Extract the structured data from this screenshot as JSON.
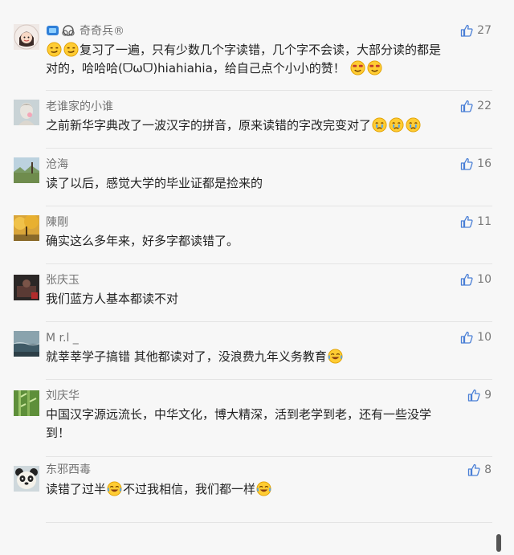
{
  "comments": [
    {
      "name": "奇奇兵®",
      "parts": [
        "",
        "复习了一遍，只有少数几个字读错，几个字不会读，大部分读的都是",
        "对的，哈哈哈(ᗜωᗜ)hiahiahia，给自己点个小小的赞！",
        ""
      ],
      "likes": "27",
      "avatar": "avatar-cartoon-girl",
      "emoji_icons": [
        "smirk-face-icon",
        "smirk-face-icon",
        "cool-face-icon",
        "cool-face-icon"
      ]
    },
    {
      "name": "老谁家的小谁",
      "parts": [
        "之前新华字典改了一波汉字的拼音，原来读错的字改完变对了",
        ""
      ],
      "likes": "22",
      "avatar": "avatar-statue",
      "emoji_icons": [
        "crying-face-icon",
        "crying-face-icon",
        "crying-face-icon"
      ]
    },
    {
      "name": "沧海",
      "parts": [
        "读了以后，感觉大学的毕业证都是捡来的"
      ],
      "likes": "16",
      "avatar": "avatar-landscape"
    },
    {
      "name": "陳剛",
      "parts": [
        "确实这么多年来，好多字都读错了。"
      ],
      "likes": "11",
      "avatar": "avatar-autumn-trees"
    },
    {
      "name": "张庆玉",
      "parts": [
        "我们蓝方人基本都读不对"
      ],
      "likes": "10",
      "avatar": "avatar-dark-photo"
    },
    {
      "name": "M r.l _",
      "parts": [
        "就莘莘学子搞错  其他都读对了，没浪费九年义务教育"
      ],
      "likes": "10",
      "avatar": "avatar-sea",
      "emoji_icons": [
        "laughing-crying-icon"
      ]
    },
    {
      "name": "刘庆华",
      "parts": [
        "中国汉字源远流长，中华文化，博大精深，活到老学到老，还有一些没学",
        "到！"
      ],
      "likes": "9",
      "avatar": "avatar-bamboo"
    },
    {
      "name": "东邪西毒",
      "parts": [
        "读错了过半",
        "不过我相信，我们都一样"
      ],
      "likes": "8",
      "avatar": "avatar-panda",
      "emoji_icons": [
        "laughing-crying-icon",
        "laughing-crying-icon"
      ]
    }
  ],
  "colors": {
    "background": "#f7f7f7",
    "name": "#737373",
    "text": "#222222",
    "like_icon": "#4a7fd6",
    "divider": "#e4e4e4"
  }
}
